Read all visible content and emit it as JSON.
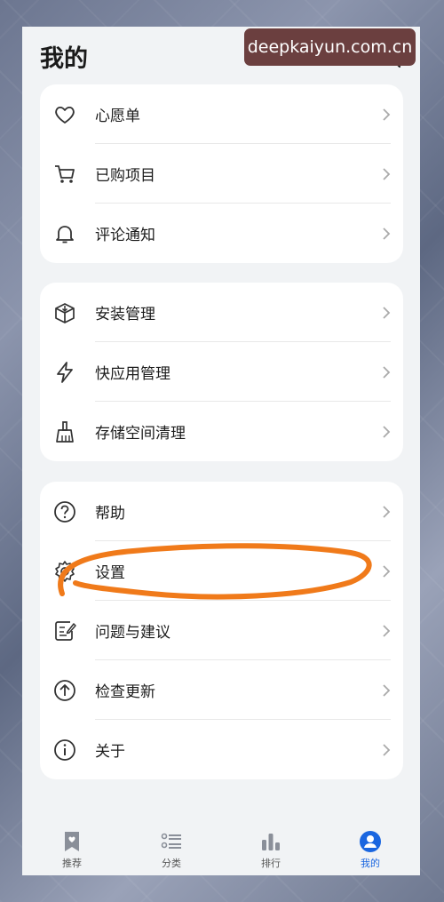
{
  "header": {
    "title": "我的"
  },
  "watermark": "deepkaiyun.com.cn",
  "sections": [
    {
      "items": [
        {
          "label": "心愿单",
          "icon": "heart-icon"
        },
        {
          "label": "已购项目",
          "icon": "cart-icon"
        },
        {
          "label": "评论通知",
          "icon": "bell-icon"
        }
      ]
    },
    {
      "items": [
        {
          "label": "安装管理",
          "icon": "package-icon"
        },
        {
          "label": "快应用管理",
          "icon": "lightning-icon"
        },
        {
          "label": "存储空间清理",
          "icon": "broom-icon"
        }
      ]
    },
    {
      "items": [
        {
          "label": "帮助",
          "icon": "help-icon"
        },
        {
          "label": "设置",
          "icon": "gear-icon"
        },
        {
          "label": "问题与建议",
          "icon": "feedback-icon"
        },
        {
          "label": "检查更新",
          "icon": "update-icon"
        },
        {
          "label": "关于",
          "icon": "info-icon"
        }
      ]
    }
  ],
  "tabs": [
    {
      "label": "推荐",
      "icon": "bookmark-heart-icon",
      "active": false
    },
    {
      "label": "分类",
      "icon": "category-list-icon",
      "active": false
    },
    {
      "label": "排行",
      "icon": "ranking-bars-icon",
      "active": false
    },
    {
      "label": "我的",
      "icon": "user-icon",
      "active": true
    }
  ],
  "colors": {
    "accent": "#1a66e0",
    "annotation": "#f07a1a",
    "watermark_bg": "#6b3f3f"
  }
}
